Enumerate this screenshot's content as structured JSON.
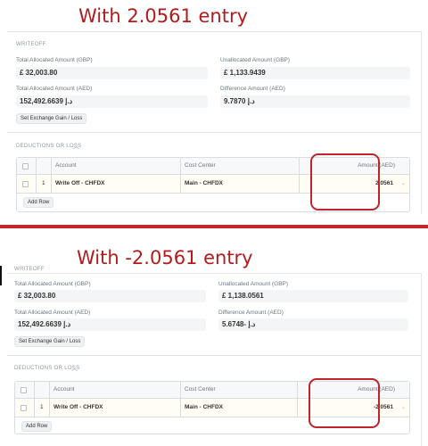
{
  "colors": {
    "annotation_red": "#c0242a",
    "divider_red": "#c5252b",
    "row_highlight": "#fffdf4"
  },
  "panels": [
    {
      "heading": "With 2.0561 entry",
      "writeoff": {
        "section_title": "WRITEOFF",
        "total_allocated_gbp": {
          "label": "Total Allocated Amount (GBP)",
          "value": "£ 32,003.80"
        },
        "unallocated_gbp": {
          "label": "Unallocated Amount (GBP)",
          "value": "£ 1,133.9439"
        },
        "total_allocated_aed": {
          "label": "Total Allocated Amount (AED)",
          "value": "152,492.6639 د.إ"
        },
        "difference_aed": {
          "label": "Difference Amount (AED)",
          "value": "9.7870 د.إ"
        },
        "exchange_button": "Set Exchange Gain / Loss"
      },
      "deductions": {
        "section_title": "DEDUCTIONS OR LOSS",
        "columns": {
          "account": "Account",
          "cost_center": "Cost Center",
          "amount": "Amount (AED)"
        },
        "rows": [
          {
            "no": "1",
            "account": "Write Off - CHFDX",
            "cost_center": "Main - CHFDX",
            "amount": "2.0561"
          }
        ],
        "add_row": "Add Row"
      }
    },
    {
      "heading": "With -2.0561 entry",
      "writeoff": {
        "section_title": "WRITEOFF",
        "total_allocated_gbp": {
          "label": "Total Allocated Amount (GBP)",
          "value": "£ 32,003.80"
        },
        "unallocated_gbp": {
          "label": "Unallocated Amount (GBP)",
          "value": "£ 1,138.0561"
        },
        "total_allocated_aed": {
          "label": "Total Allocated Amount (AED)",
          "value": "152,492.6639 د.إ"
        },
        "difference_aed": {
          "label": "Difference Amount (AED)",
          "value": "5.6748- د.إ"
        },
        "exchange_button": "Set Exchange Gain / Loss"
      },
      "deductions": {
        "section_title": "DEDUCTIONS OR LOSS",
        "columns": {
          "account": "Account",
          "cost_center": "Cost Center",
          "amount": "Amount (AED)"
        },
        "rows": [
          {
            "no": "1",
            "account": "Write Off - CHFDX",
            "cost_center": "Main - CHFDX",
            "amount": "-2.0561"
          }
        ],
        "add_row": "Add Row"
      }
    }
  ]
}
